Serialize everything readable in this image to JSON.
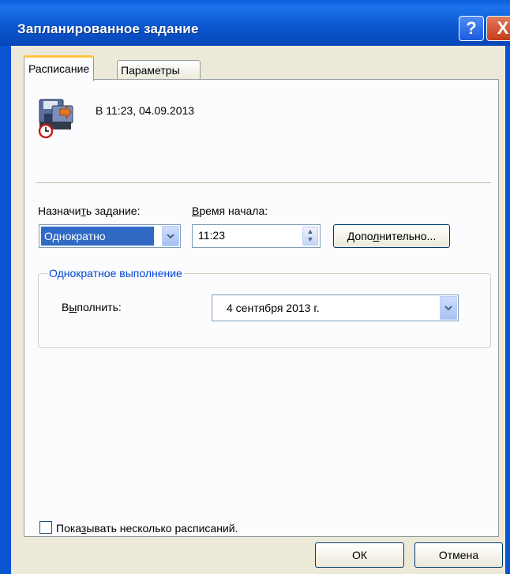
{
  "window": {
    "title": "Запланированное задание",
    "help_button": "?",
    "close_button": "X"
  },
  "tabs": [
    {
      "label": "Расписание",
      "active": true
    },
    {
      "label": "Параметры",
      "active": false
    }
  ],
  "summary": {
    "icon": "scheduled-task-icon",
    "text": "В 11:23, 04.09.2013"
  },
  "schedule": {
    "label_prefix": "Назначи",
    "label_hotkey": "т",
    "label_suffix": "ь задание:",
    "value": "Однократно"
  },
  "start_time": {
    "label_hotkey": "В",
    "label_suffix": "ремя начала:",
    "value": "11:23"
  },
  "advanced_button": {
    "prefix": "Допо",
    "hotkey": "л",
    "suffix": "нительно..."
  },
  "once_group": {
    "title": "Однократное выполнение",
    "run_label_prefix": "В",
    "run_label_hotkey": "ы",
    "run_label_suffix": "полнить:",
    "run_date": "4 сентября 2013 г."
  },
  "multiple_schedules": {
    "label_prefix": "Пока",
    "label_hotkey": "з",
    "label_suffix": "ывать несколько расписаний.",
    "checked": false
  },
  "footer": {
    "ok_label": "ОК",
    "cancel_label": "Отмена"
  },
  "colors": {
    "title_bar": "#0b57d0",
    "selection": "#316ac5",
    "group_title": "#0046d5",
    "tab_highlight": "#ffc83c"
  }
}
